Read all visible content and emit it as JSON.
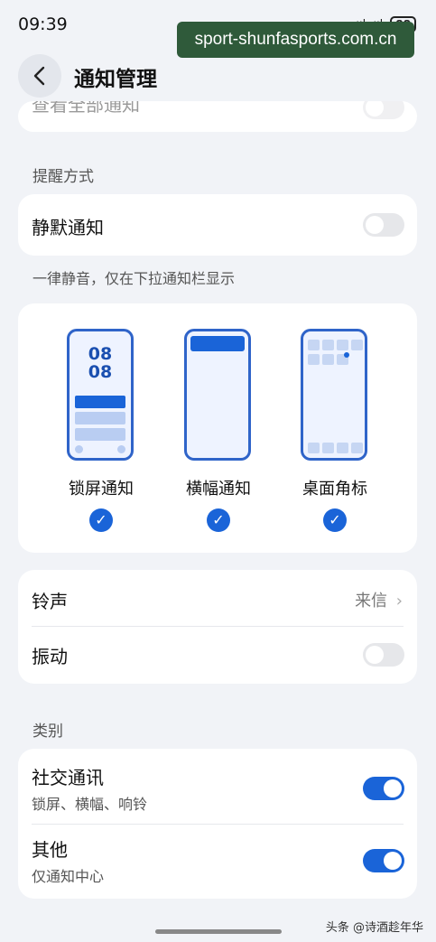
{
  "status_bar": {
    "time": "09:39",
    "signal_text": "·ııl ·ııl",
    "battery": "88"
  },
  "watermark_top": "sport-shunfasports.com.cn",
  "header": {
    "title": "通知管理",
    "back_icon": "chevron-left-icon"
  },
  "partial_row_label": "查看全部通知",
  "reminder": {
    "section_label": "提醒方式",
    "silent_label": "静默通知",
    "silent_on": false,
    "hint": "一律静音，仅在下拉通知栏显示"
  },
  "styles": {
    "lockscreen_time_top": "08",
    "lockscreen_time_bottom": "08",
    "items": [
      {
        "label": "锁屏通知",
        "checked": true
      },
      {
        "label": "横幅通知",
        "checked": true
      },
      {
        "label": "桌面角标",
        "checked": true
      }
    ],
    "check_glyph": "✓"
  },
  "sound": {
    "ringtone_label": "铃声",
    "ringtone_value": "来信",
    "chevron": "›",
    "vibration_label": "振动",
    "vibration_on": false
  },
  "category": {
    "section_label": "类别",
    "items": [
      {
        "label": "社交通讯",
        "sub": "锁屏、横幅、响铃",
        "on": true
      },
      {
        "label": "其他",
        "sub": "仅通知中心",
        "on": true
      }
    ]
  },
  "watermark_bottom": "头条 @诗酒趁年华",
  "colors": {
    "accent": "#1a64d8",
    "background": "#f1f3f7",
    "card": "#ffffff"
  }
}
